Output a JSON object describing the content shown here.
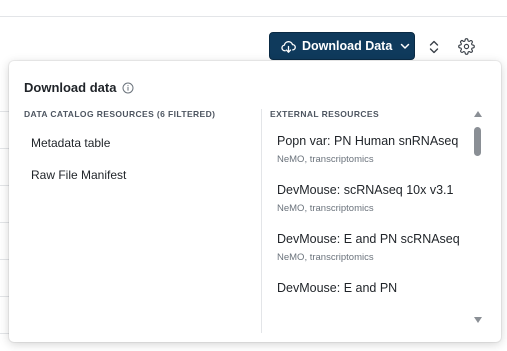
{
  "toolbar": {
    "download_label": "Download Data"
  },
  "panel": {
    "title": "Download data",
    "left_header": "DATA CATALOG RESOURCES (6 FILTERED)",
    "left_items": [
      {
        "label": "Metadata table"
      },
      {
        "label": "Raw File Manifest"
      }
    ],
    "right_header": "EXTERNAL RESOURCES",
    "external": [
      {
        "title": "Popn var: PN Human snRNAseq",
        "meta": "NeMO, transcriptomics"
      },
      {
        "title": "DevMouse: scRNAseq 10x v3.1",
        "meta": "NeMO, transcriptomics"
      },
      {
        "title": "DevMouse: E and PN scRNAseq",
        "meta": "NeMO, transcriptomics"
      },
      {
        "title": "DevMouse: E and PN",
        "meta": ""
      }
    ]
  },
  "colors": {
    "primary": "#0f3a5c",
    "text": "#1f2328",
    "muted": "#6b737c"
  }
}
